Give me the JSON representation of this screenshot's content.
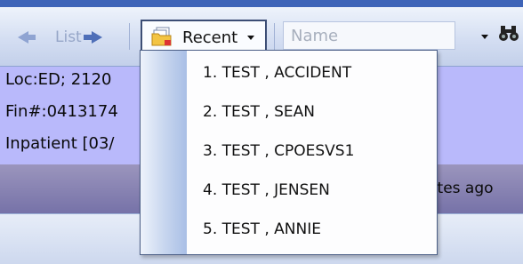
{
  "toolbar": {
    "list_label": "List",
    "recent_label": "Recent",
    "name_placeholder": "Name"
  },
  "patient_banner": {
    "line1": "Loc:ED; 2120",
    "line2": "Fin#:0413174",
    "line3": "Inpatient [03/",
    "updated_text": "nutes ago"
  },
  "recent_menu": {
    "items": [
      "1. TEST , ACCIDENT",
      "2. TEST , SEAN",
      "3. TEST , CPOESVS1",
      "4. TEST , JENSEN",
      "5. TEST , ANNIE"
    ]
  },
  "colors": {
    "banner_bg": "#b9b9fb",
    "toolbar_accent": "#3e64b8"
  }
}
